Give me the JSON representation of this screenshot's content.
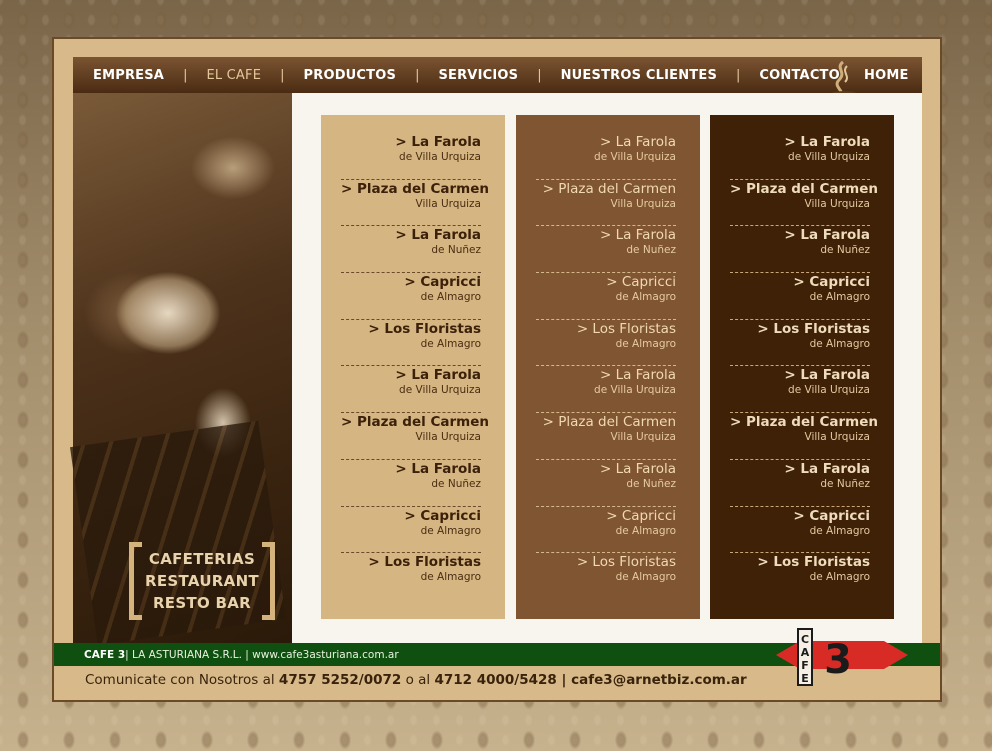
{
  "nav": {
    "items": [
      "EMPRESA",
      "EL CAFE",
      "PRODUCTOS",
      "SERVICIOS",
      "NUESTROS CLIENTES",
      "CONTACTO"
    ],
    "separator": "|",
    "home": "HOME",
    "active_index": 1
  },
  "photo_label": [
    "CAFETERIAS",
    "RESTAURANT",
    "RESTO BAR"
  ],
  "columns": [
    {
      "entries": [
        {
          "name": "> La Farola",
          "sub": "de Villa Urquiza"
        },
        {
          "name": "> Plaza del Carmen",
          "sub": "Villa Urquiza"
        },
        {
          "name": "> La Farola",
          "sub": "de Nuñez"
        },
        {
          "name": "> Capricci",
          "sub": "de Almagro"
        },
        {
          "name": "> Los Floristas",
          "sub": "de Almagro"
        },
        {
          "name": "> La Farola",
          "sub": "de Villa Urquiza"
        },
        {
          "name": "> Plaza del Carmen",
          "sub": "Villa Urquiza"
        },
        {
          "name": "> La Farola",
          "sub": "de Nuñez"
        },
        {
          "name": "> Capricci",
          "sub": "de Almagro"
        },
        {
          "name": "> Los Floristas",
          "sub": "de Almagro"
        }
      ]
    },
    {
      "entries": [
        {
          "name": "> La Farola",
          "sub": "de Villa Urquiza"
        },
        {
          "name": "> Plaza del Carmen",
          "sub": "Villa Urquiza"
        },
        {
          "name": "> La Farola",
          "sub": "de Nuñez"
        },
        {
          "name": "> Capricci",
          "sub": "de Almagro"
        },
        {
          "name": "> Los Floristas",
          "sub": "de Almagro"
        },
        {
          "name": "> La Farola",
          "sub": "de Villa Urquiza"
        },
        {
          "name": "> Plaza del Carmen",
          "sub": "Villa Urquiza"
        },
        {
          "name": "> La Farola",
          "sub": "de Nuñez"
        },
        {
          "name": "> Capricci",
          "sub": "de Almagro"
        },
        {
          "name": "> Los Floristas",
          "sub": "de Almagro"
        }
      ]
    },
    {
      "entries": [
        {
          "name": "> La Farola",
          "sub": "de Villa Urquiza"
        },
        {
          "name": "> Plaza del Carmen",
          "sub": "Villa Urquiza"
        },
        {
          "name": "> La Farola",
          "sub": "de Nuñez"
        },
        {
          "name": "> Capricci",
          "sub": "de Almagro"
        },
        {
          "name": "> Los Floristas",
          "sub": "de Almagro"
        },
        {
          "name": "> La Farola",
          "sub": "de Villa Urquiza"
        },
        {
          "name": "> Plaza del Carmen",
          "sub": "Villa Urquiza"
        },
        {
          "name": "> La Farola",
          "sub": "de Nuñez"
        },
        {
          "name": "> Capricci",
          "sub": "de Almagro"
        },
        {
          "name": "> Los Floristas",
          "sub": "de Almagro"
        }
      ]
    }
  ],
  "footer": {
    "brand": "CAFE 3",
    "company": " | LA ASTURIANA S.R.L. | www.cafe3asturiana.com.ar",
    "contact_prefix": "Comunicate con Nosotros al ",
    "phone1": "4757 5252/0072",
    "contact_mid": " o al ",
    "phone2": "4712 4000/5428",
    "contact_sep": " | ",
    "email": "cafe3@arnetbiz.com.ar"
  },
  "logo": {
    "vertical_text": "CAFE",
    "number": "3"
  },
  "colors": {
    "frame": "#d8ba8a",
    "nav_bar": "#4a2b12",
    "col_light": "#d5b581",
    "col_mid": "#805532",
    "col_dark": "#3e2107",
    "footer_green": "#0f5010",
    "logo_red": "#d92b26"
  }
}
